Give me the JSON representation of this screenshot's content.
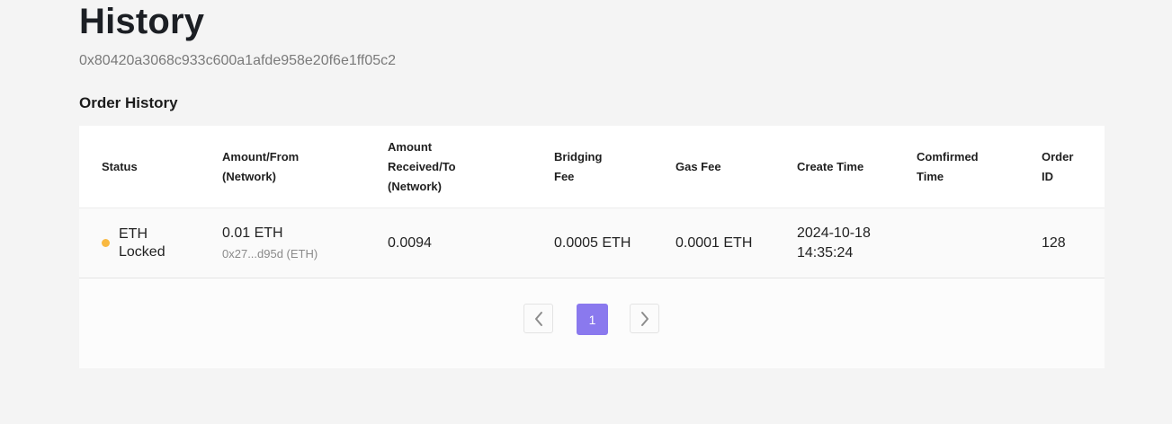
{
  "page": {
    "title": "History",
    "address": "0x80420a3068c933c600a1afde958e20f6e1ff05c2",
    "section_title": "Order History"
  },
  "table": {
    "headers": {
      "status": "Status",
      "amount_from_1": "Amount/From",
      "amount_from_2": "(Network)",
      "amount_received_1": "Amount",
      "amount_received_2": "Received/To",
      "amount_received_3": "(Network)",
      "bridging_fee_1": "Bridging",
      "bridging_fee_2": "Fee",
      "gas_fee": "Gas Fee",
      "create_time": "Create Time",
      "confirmed_time_1": "Comfirmed",
      "confirmed_time_2": "Time",
      "order_id_1": "Order",
      "order_id_2": "ID"
    },
    "rows": [
      {
        "status_line1": "ETH",
        "status_line2": "Locked",
        "status_color": "#f9b941",
        "amount": "0.01 ETH",
        "from": "0x27...d95d (ETH)",
        "received": "0.0094",
        "bridging_fee": "0.0005 ETH",
        "gas_fee": "0.0001 ETH",
        "create_date": "2024-10-18",
        "create_clock": "14:35:24",
        "confirmed_time": "",
        "order_id": "128"
      }
    ]
  },
  "pagination": {
    "current_page": "1",
    "prev_icon": "chevron-left-icon",
    "next_icon": "chevron-right-icon",
    "accent_color": "#8a79ee"
  }
}
